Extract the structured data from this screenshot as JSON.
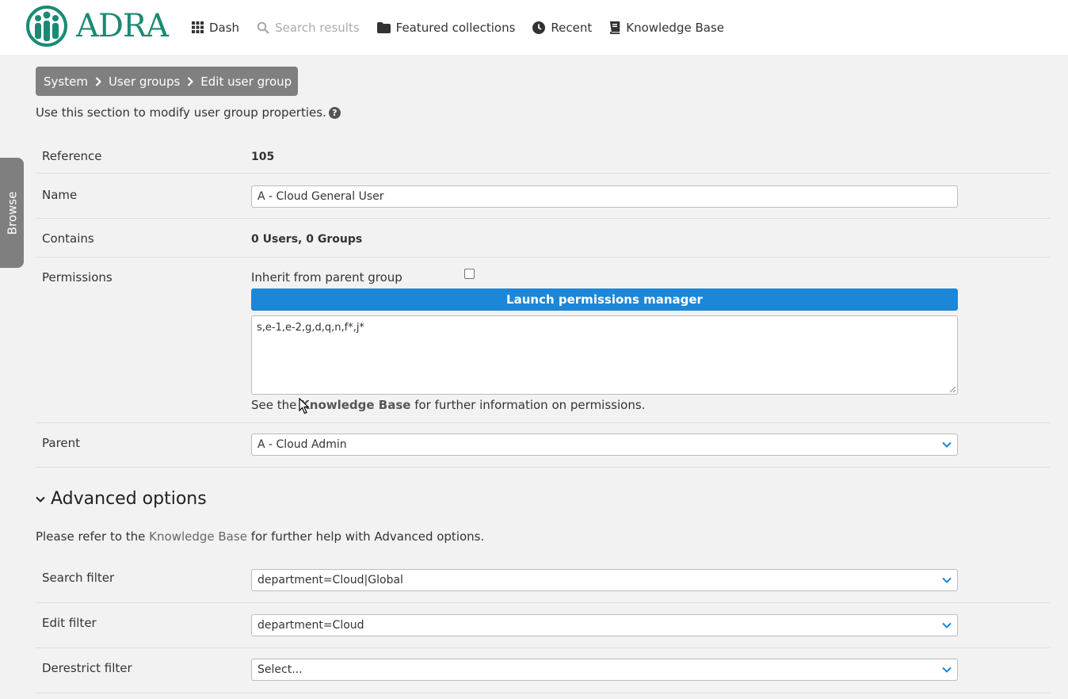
{
  "header": {
    "logo_text": "ADRA",
    "nav": [
      {
        "label": "Dash",
        "icon": "grid-icon"
      },
      {
        "label": "Search results",
        "icon": "search-icon",
        "disabled": true
      },
      {
        "label": "Featured collections",
        "icon": "folder-icon"
      },
      {
        "label": "Recent",
        "icon": "clock-icon"
      },
      {
        "label": "Knowledge Base",
        "icon": "book-icon"
      }
    ]
  },
  "browse_tab": "Browse",
  "breadcrumb": [
    "System",
    "User groups",
    "Edit user group"
  ],
  "intro": "Use this section to modify user group properties.",
  "help_icon_glyph": "?",
  "fields": {
    "reference": {
      "label": "Reference",
      "value": "105"
    },
    "name": {
      "label": "Name",
      "value": "A - Cloud General User"
    },
    "contains": {
      "label": "Contains",
      "value": "0 Users, 0 Groups"
    },
    "permissions": {
      "label": "Permissions",
      "inherit_label": "Inherit from parent group",
      "inherit_checked": false,
      "button": "Launch permissions manager",
      "value": "s,e-1,e-2,g,d,q,n,f*,j*",
      "note_before": "See the ",
      "note_link": "Knowledge Base",
      "note_after": " for further information on permissions."
    },
    "parent": {
      "label": "Parent",
      "value": "A - Cloud Admin"
    }
  },
  "advanced": {
    "title": "Advanced options",
    "note_before": "Please refer to the ",
    "note_link": "Knowledge Base",
    "note_after": " for further help with Advanced options.",
    "search_filter": {
      "label": "Search filter",
      "value": "department=Cloud|Global"
    },
    "edit_filter": {
      "label": "Edit filter",
      "value": "department=Cloud"
    },
    "derestrict_filter": {
      "label": "Derestrict filter",
      "value": "Select..."
    }
  },
  "colors": {
    "brand": "#1b8a73",
    "primary_button": "#1c87d8",
    "breadcrumb_bg": "#808080",
    "chevron": "#1c87d8"
  }
}
